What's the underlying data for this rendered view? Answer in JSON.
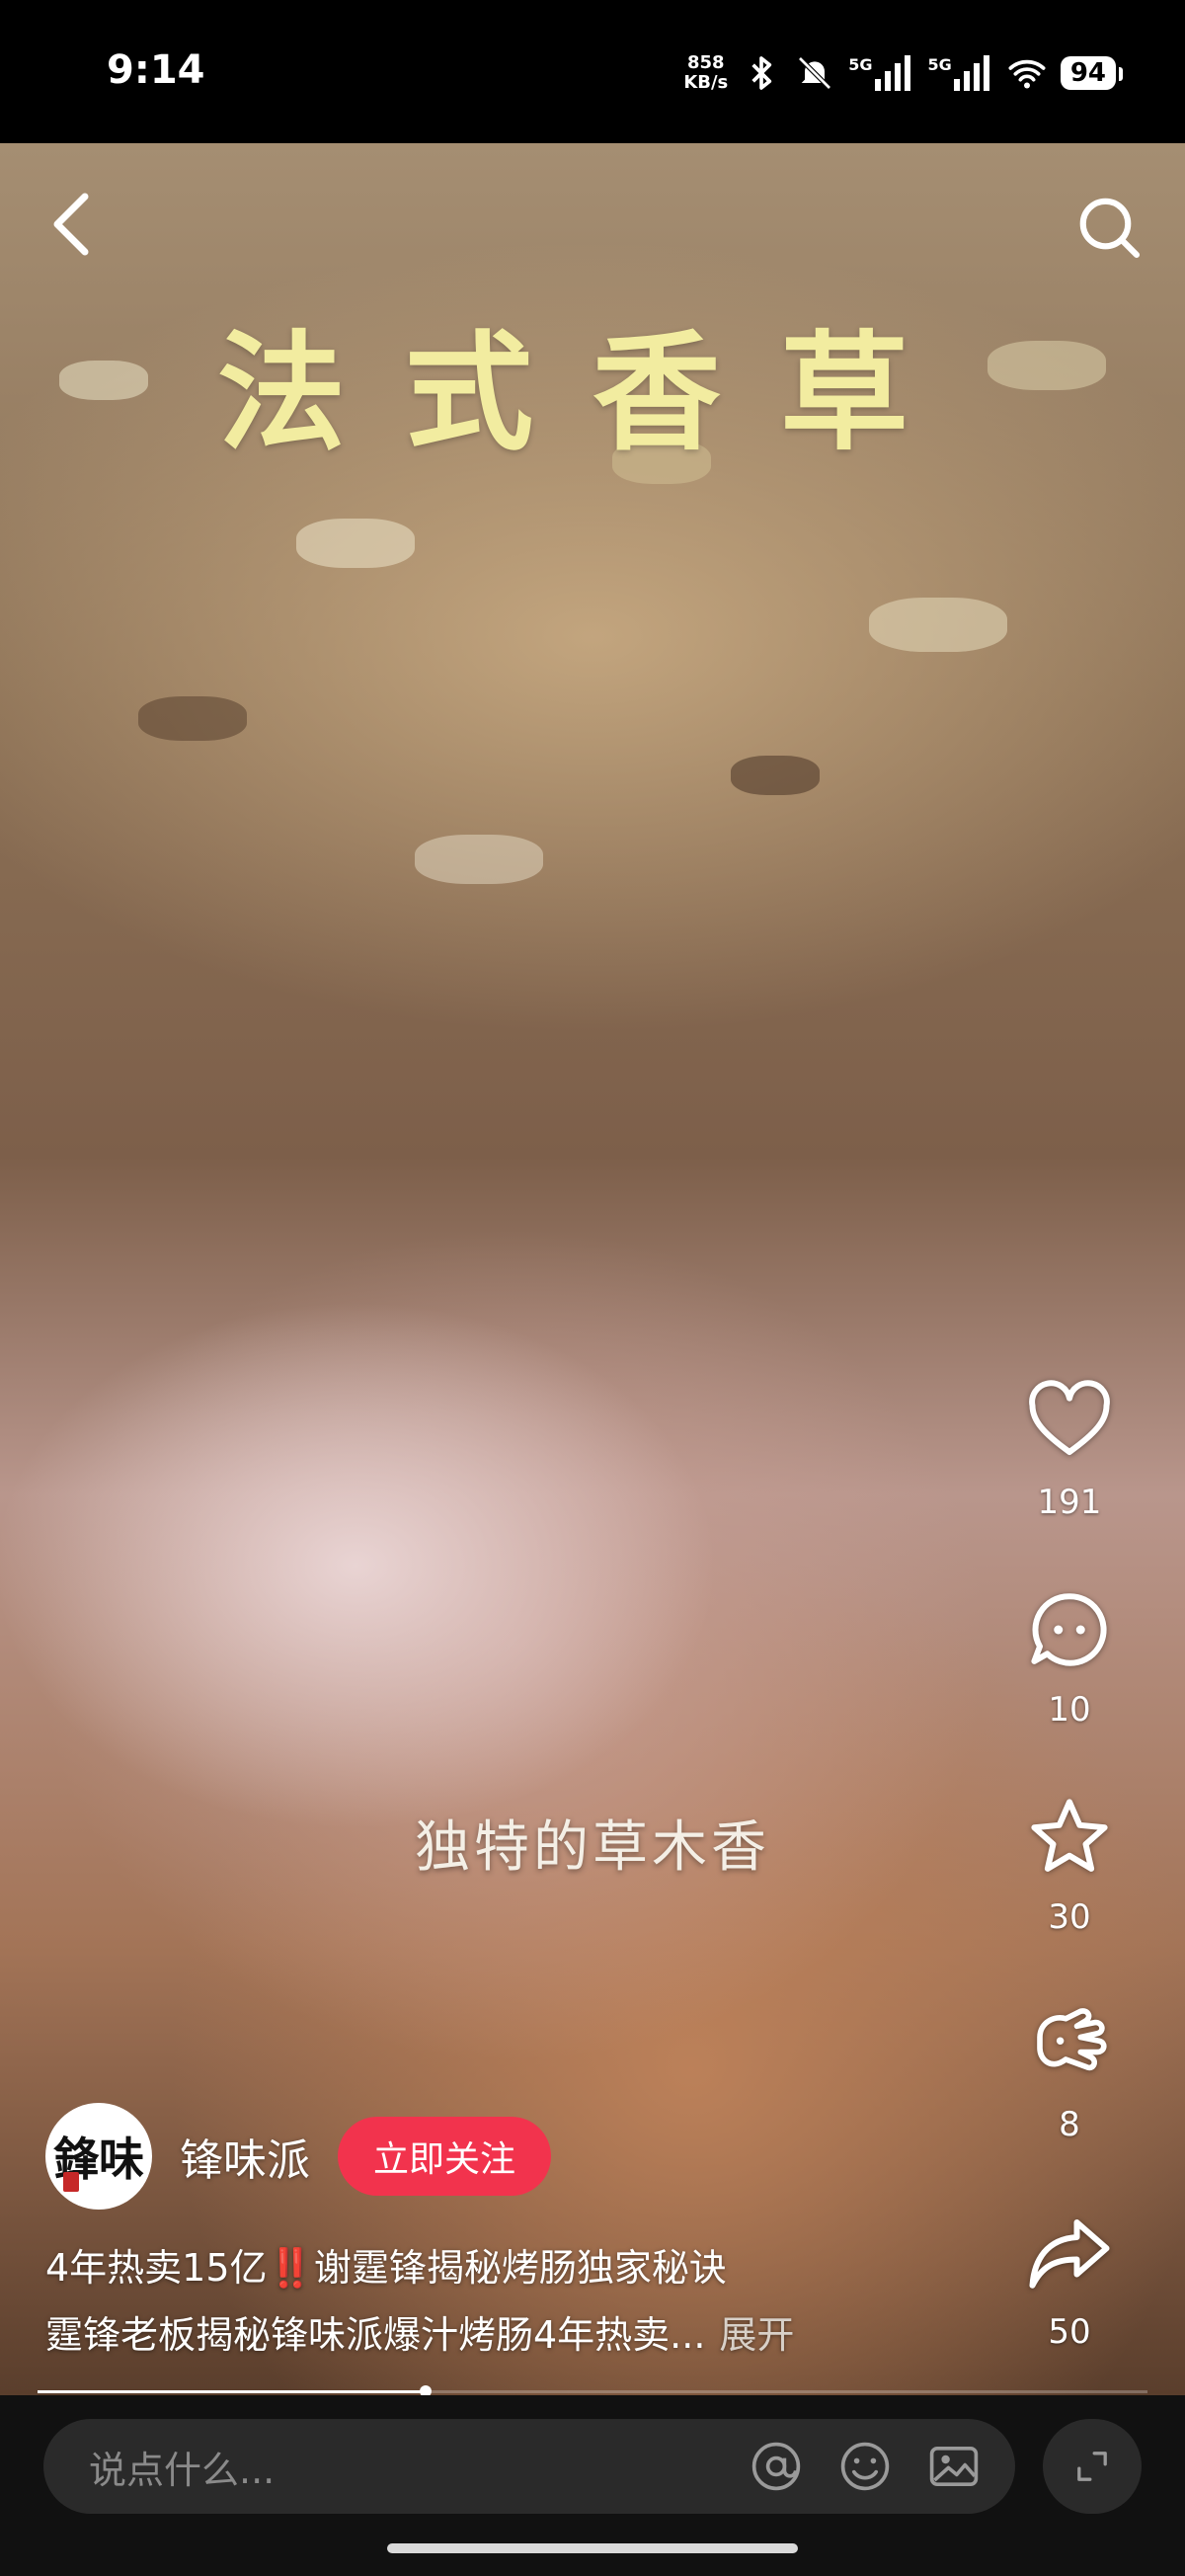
{
  "status_bar": {
    "time": "9:14",
    "net_speed_value": "858",
    "net_speed_unit": "KB/s",
    "signal1_label": "5G",
    "signal2_label": "5G",
    "battery": "94",
    "icons": [
      "bluetooth-icon",
      "mute-icon",
      "signal-icon",
      "signal-icon",
      "wifi-icon",
      "battery-icon"
    ]
  },
  "video": {
    "title_overlay": "法式香草",
    "caption": "独特的草木香",
    "progress": 0.35
  },
  "actions": [
    {
      "icon": "heart-icon",
      "count": "191"
    },
    {
      "icon": "comment-icon",
      "count": "10"
    },
    {
      "icon": "star-icon",
      "count": "30"
    },
    {
      "icon": "hand-icon",
      "count": "8"
    },
    {
      "icon": "share-icon",
      "count": "50"
    }
  ],
  "author": {
    "avatar_text": "鋒味",
    "name": "锋味派",
    "follow_label": "立即关注"
  },
  "description": {
    "line1": "4年热卖15亿‼️谢霆锋揭秘烤肠独家秘诀",
    "line2": "霆锋老板揭秘锋味派爆汁烤肠4年热卖...",
    "expand": "展开"
  },
  "comment_box": {
    "placeholder": "说点什么..."
  },
  "colors": {
    "follow_button": "#f2334d",
    "title_overlay": "#f2eca0",
    "input_bg": "#2a2a2a"
  }
}
